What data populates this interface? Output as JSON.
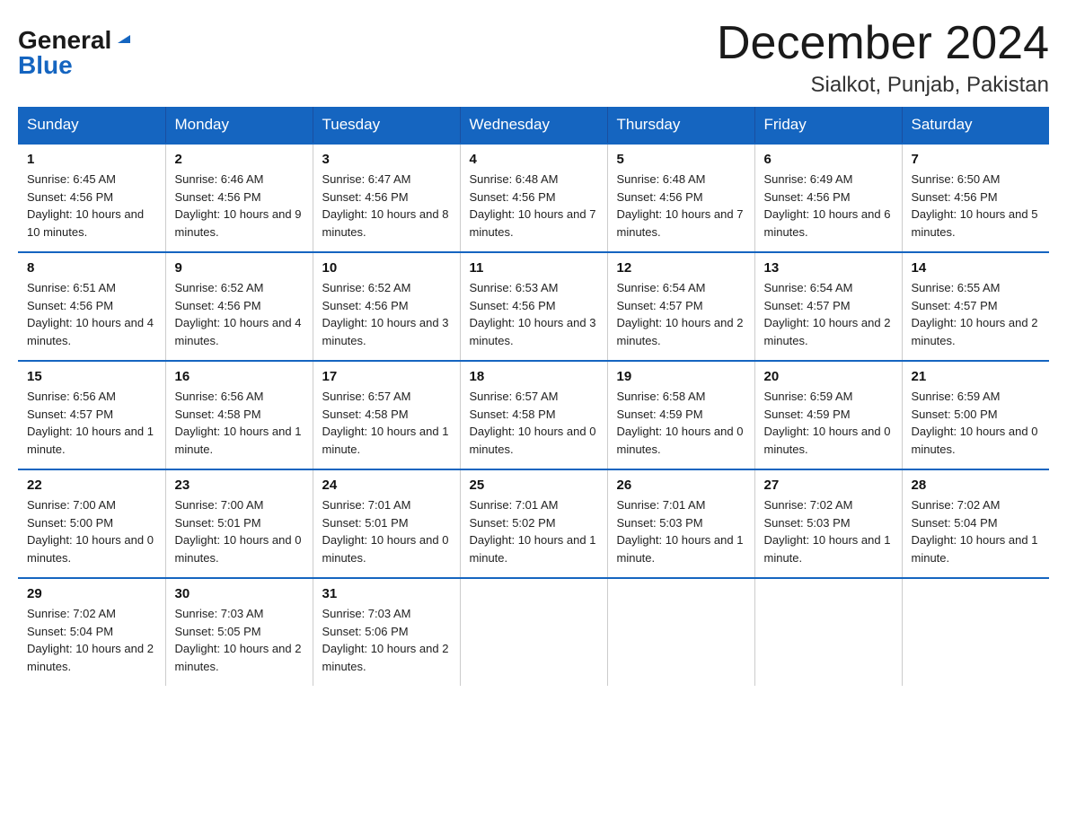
{
  "header": {
    "logo_general": "General",
    "logo_arrow": "▶",
    "logo_blue": "Blue",
    "month_title": "December 2024",
    "location": "Sialkot, Punjab, Pakistan"
  },
  "days_of_week": [
    "Sunday",
    "Monday",
    "Tuesday",
    "Wednesday",
    "Thursday",
    "Friday",
    "Saturday"
  ],
  "weeks": [
    [
      {
        "day": "1",
        "sunrise": "6:45 AM",
        "sunset": "4:56 PM",
        "daylight": "10 hours and 10 minutes."
      },
      {
        "day": "2",
        "sunrise": "6:46 AM",
        "sunset": "4:56 PM",
        "daylight": "10 hours and 9 minutes."
      },
      {
        "day": "3",
        "sunrise": "6:47 AM",
        "sunset": "4:56 PM",
        "daylight": "10 hours and 8 minutes."
      },
      {
        "day": "4",
        "sunrise": "6:48 AM",
        "sunset": "4:56 PM",
        "daylight": "10 hours and 7 minutes."
      },
      {
        "day": "5",
        "sunrise": "6:48 AM",
        "sunset": "4:56 PM",
        "daylight": "10 hours and 7 minutes."
      },
      {
        "day": "6",
        "sunrise": "6:49 AM",
        "sunset": "4:56 PM",
        "daylight": "10 hours and 6 minutes."
      },
      {
        "day": "7",
        "sunrise": "6:50 AM",
        "sunset": "4:56 PM",
        "daylight": "10 hours and 5 minutes."
      }
    ],
    [
      {
        "day": "8",
        "sunrise": "6:51 AM",
        "sunset": "4:56 PM",
        "daylight": "10 hours and 4 minutes."
      },
      {
        "day": "9",
        "sunrise": "6:52 AM",
        "sunset": "4:56 PM",
        "daylight": "10 hours and 4 minutes."
      },
      {
        "day": "10",
        "sunrise": "6:52 AM",
        "sunset": "4:56 PM",
        "daylight": "10 hours and 3 minutes."
      },
      {
        "day": "11",
        "sunrise": "6:53 AM",
        "sunset": "4:56 PM",
        "daylight": "10 hours and 3 minutes."
      },
      {
        "day": "12",
        "sunrise": "6:54 AM",
        "sunset": "4:57 PM",
        "daylight": "10 hours and 2 minutes."
      },
      {
        "day": "13",
        "sunrise": "6:54 AM",
        "sunset": "4:57 PM",
        "daylight": "10 hours and 2 minutes."
      },
      {
        "day": "14",
        "sunrise": "6:55 AM",
        "sunset": "4:57 PM",
        "daylight": "10 hours and 2 minutes."
      }
    ],
    [
      {
        "day": "15",
        "sunrise": "6:56 AM",
        "sunset": "4:57 PM",
        "daylight": "10 hours and 1 minute."
      },
      {
        "day": "16",
        "sunrise": "6:56 AM",
        "sunset": "4:58 PM",
        "daylight": "10 hours and 1 minute."
      },
      {
        "day": "17",
        "sunrise": "6:57 AM",
        "sunset": "4:58 PM",
        "daylight": "10 hours and 1 minute."
      },
      {
        "day": "18",
        "sunrise": "6:57 AM",
        "sunset": "4:58 PM",
        "daylight": "10 hours and 0 minutes."
      },
      {
        "day": "19",
        "sunrise": "6:58 AM",
        "sunset": "4:59 PM",
        "daylight": "10 hours and 0 minutes."
      },
      {
        "day": "20",
        "sunrise": "6:59 AM",
        "sunset": "4:59 PM",
        "daylight": "10 hours and 0 minutes."
      },
      {
        "day": "21",
        "sunrise": "6:59 AM",
        "sunset": "5:00 PM",
        "daylight": "10 hours and 0 minutes."
      }
    ],
    [
      {
        "day": "22",
        "sunrise": "7:00 AM",
        "sunset": "5:00 PM",
        "daylight": "10 hours and 0 minutes."
      },
      {
        "day": "23",
        "sunrise": "7:00 AM",
        "sunset": "5:01 PM",
        "daylight": "10 hours and 0 minutes."
      },
      {
        "day": "24",
        "sunrise": "7:01 AM",
        "sunset": "5:01 PM",
        "daylight": "10 hours and 0 minutes."
      },
      {
        "day": "25",
        "sunrise": "7:01 AM",
        "sunset": "5:02 PM",
        "daylight": "10 hours and 1 minute."
      },
      {
        "day": "26",
        "sunrise": "7:01 AM",
        "sunset": "5:03 PM",
        "daylight": "10 hours and 1 minute."
      },
      {
        "day": "27",
        "sunrise": "7:02 AM",
        "sunset": "5:03 PM",
        "daylight": "10 hours and 1 minute."
      },
      {
        "day": "28",
        "sunrise": "7:02 AM",
        "sunset": "5:04 PM",
        "daylight": "10 hours and 1 minute."
      }
    ],
    [
      {
        "day": "29",
        "sunrise": "7:02 AM",
        "sunset": "5:04 PM",
        "daylight": "10 hours and 2 minutes."
      },
      {
        "day": "30",
        "sunrise": "7:03 AM",
        "sunset": "5:05 PM",
        "daylight": "10 hours and 2 minutes."
      },
      {
        "day": "31",
        "sunrise": "7:03 AM",
        "sunset": "5:06 PM",
        "daylight": "10 hours and 2 minutes."
      },
      null,
      null,
      null,
      null
    ]
  ]
}
